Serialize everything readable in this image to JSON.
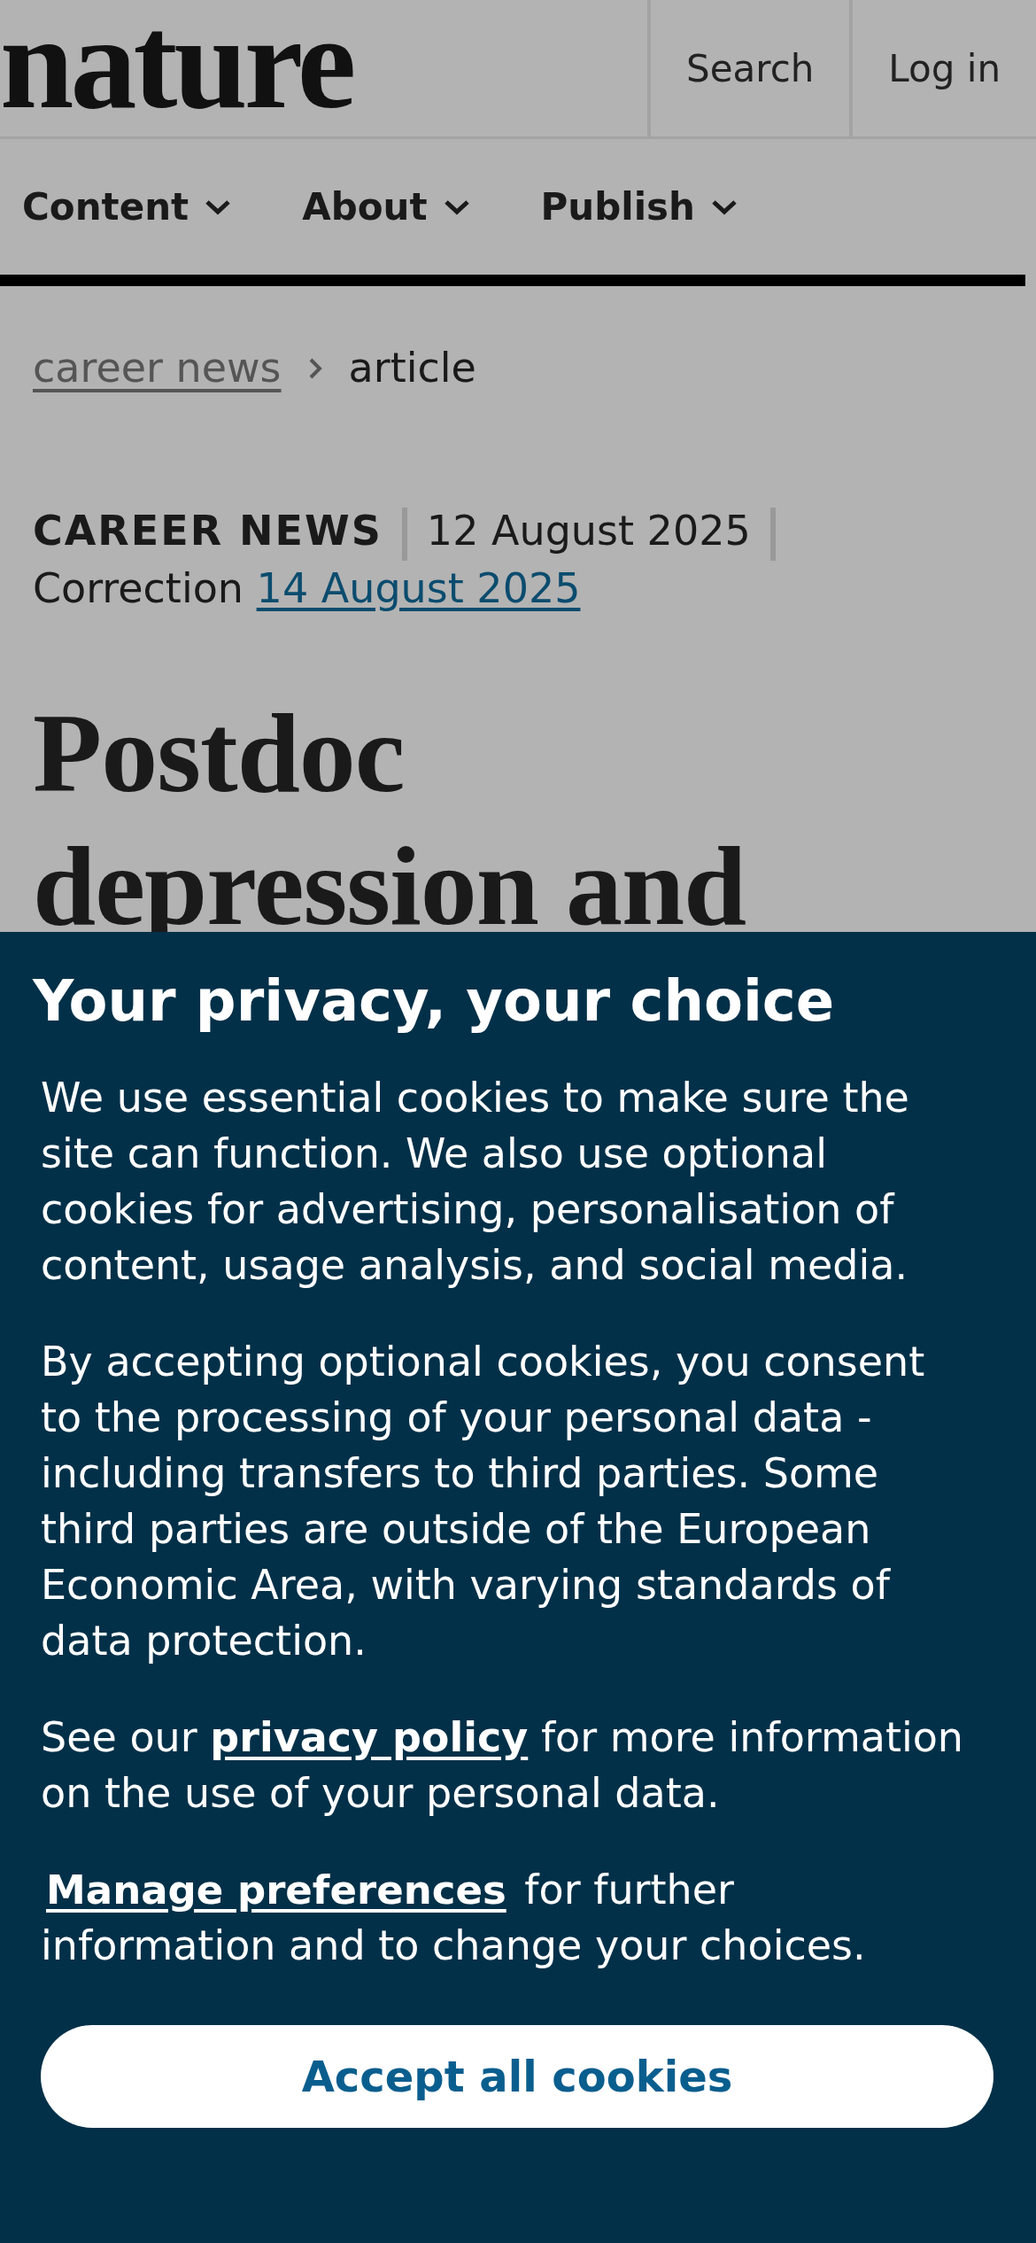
{
  "header": {
    "logo": "nature",
    "actions": [
      {
        "label": "Search"
      },
      {
        "label": "Log in"
      }
    ]
  },
  "nav": [
    {
      "label": "Content"
    },
    {
      "label": "About"
    },
    {
      "label": "Publish"
    }
  ],
  "breadcrumb": [
    {
      "label": "career news",
      "kind": "link"
    },
    {
      "label": "article",
      "kind": "current"
    }
  ],
  "meta": {
    "type": "CAREER NEWS",
    "date": "12 August 2025",
    "correction_label": "Correction",
    "correction_date": "14 August 2025"
  },
  "headline": [
    "Postdoc",
    "depression and"
  ],
  "cookie_banner": {
    "title": "Your privacy, your choice",
    "paragraphs": [
      [
        {
          "text": "We use essential cookies to make sure the site can function. We also use optional cookies for advertising, personalisation of content, usage analysis, and social media."
        }
      ],
      [
        {
          "text": "By accepting optional cookies, you consent to the processing of your personal data - including transfers to third parties. Some third parties are outside of the European Economic Area, with varying standards of data protection."
        }
      ],
      [
        {
          "text": "See our "
        },
        {
          "text": "privacy policy",
          "kind": "link"
        },
        {
          "text": " for more information on the use of your personal data."
        }
      ],
      [
        {
          "text": "Manage preferences",
          "kind": "button"
        },
        {
          "text": " for further information and to change your choices."
        }
      ]
    ],
    "button": "Accept all cookies"
  }
}
